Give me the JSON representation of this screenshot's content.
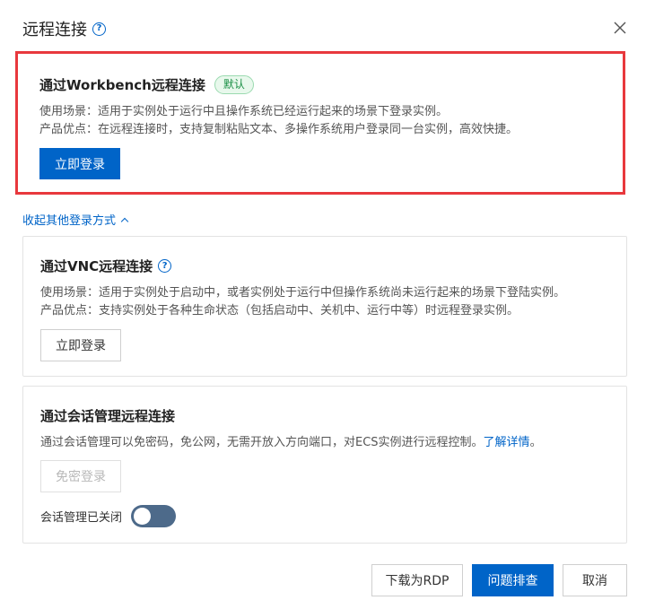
{
  "dialog": {
    "title": "远程连接",
    "help_icon": "question-circle-icon",
    "close_icon": "close-icon"
  },
  "workbench": {
    "title": "通过Workbench远程连接",
    "badge": "默认",
    "scenario": "使用场景：适用于实例处于运行中且操作系统已经运行起来的场景下登录实例。",
    "advantage": "产品优点：在远程连接时，支持复制粘贴文本、多操作系统用户登录同一台实例，高效快捷。",
    "login_label": "立即登录"
  },
  "collapse_link": "收起其他登录方式",
  "vnc": {
    "title": "通过VNC远程连接",
    "scenario": "使用场景：适用于实例处于启动中，或者实例处于运行中但操作系统尚未运行起来的场景下登陆实例。",
    "advantage": "产品优点：支持实例处于各种生命状态（包括启动中、关机中、运行中等）时远程登录实例。",
    "login_label": "立即登录"
  },
  "session_manager": {
    "title": "通过会话管理远程连接",
    "description": "通过会话管理可以免密码，免公网，无需开放入方向端口，对ECS实例进行远程控制。",
    "learn_more": "了解详情",
    "period": "。",
    "login_label": "免密登录",
    "toggle_label": "会话管理已关闭",
    "toggle_state": "off"
  },
  "footer": {
    "download_rdp": "下载为RDP",
    "troubleshoot": "问题排查",
    "cancel": "取消"
  },
  "colors": {
    "primary": "#0064c8",
    "highlight_border": "#e8383d",
    "badge_green": "#1a8f45",
    "toggle_off": "#4d6a8a"
  }
}
